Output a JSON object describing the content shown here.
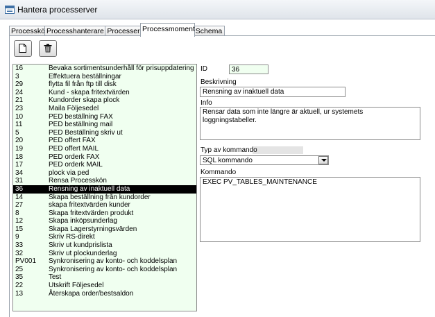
{
  "window": {
    "title": "Hantera processerver"
  },
  "tabs": [
    {
      "label": "Processkö"
    },
    {
      "label": "Processhanterare"
    },
    {
      "label": "Processer"
    },
    {
      "label": "Processmoment"
    },
    {
      "label": "Schema"
    }
  ],
  "toolbar": {
    "new_icon": "new-document-icon",
    "delete_icon": "trash-icon"
  },
  "list": {
    "rows": [
      {
        "id": "16",
        "name": "Bevaka sortimentsunderhåll för prisuppdatering"
      },
      {
        "id": "3",
        "name": "Effektuera beställningar"
      },
      {
        "id": "29",
        "name": "flytta fil från ftp till disk"
      },
      {
        "id": "24",
        "name": "Kund - skapa fritextvärden"
      },
      {
        "id": "21",
        "name": "Kundorder skapa plock"
      },
      {
        "id": "23",
        "name": "Maila Följesedel"
      },
      {
        "id": "10",
        "name": "PED beställning FAX"
      },
      {
        "id": "11",
        "name": "PED beställning mail"
      },
      {
        "id": "5",
        "name": "PED Beställning skriv ut"
      },
      {
        "id": "20",
        "name": "PED offert FAX"
      },
      {
        "id": "19",
        "name": "PED offert MAIL"
      },
      {
        "id": "18",
        "name": "PED orderk FAX"
      },
      {
        "id": "17",
        "name": "PED orderk MAIL"
      },
      {
        "id": "34",
        "name": "plock via ped"
      },
      {
        "id": "31",
        "name": "Rensa Processkön"
      },
      {
        "id": "36",
        "name": "Rensning av inaktuell data"
      },
      {
        "id": "14",
        "name": "Skapa beställning från kundorder"
      },
      {
        "id": "27",
        "name": "skapa fritextvärden kunder"
      },
      {
        "id": "8",
        "name": "Skapa fritextvärden produkt"
      },
      {
        "id": "12",
        "name": "Skapa inköpsunderlag"
      },
      {
        "id": "15",
        "name": "Skapa Lagerstyrningsvärden"
      },
      {
        "id": "9",
        "name": "Skriv  RS-direkt"
      },
      {
        "id": "33",
        "name": "Skriv ut kundprislista"
      },
      {
        "id": "32",
        "name": "Skriv ut plockunderlag"
      },
      {
        "id": "PV001",
        "name": "Synkronisering av konto- och koddelsplan"
      },
      {
        "id": "25",
        "name": "Synkronisering av konto- och koddelsplan"
      },
      {
        "id": "35",
        "name": "Test"
      },
      {
        "id": "22",
        "name": "Utskrift Följesedel"
      },
      {
        "id": "13",
        "name": "Återskapa order/bestsaldon"
      }
    ]
  },
  "form": {
    "id_label": "ID",
    "id_value": "36",
    "beskrivning_label": "Beskrivning",
    "beskrivning_value": "Rensning av inaktuell data",
    "info_label": "Info",
    "info_value": "Rensar data som inte längre är aktuell, ur systemets loggningstabeller.",
    "typ_label": "Typ av kommando",
    "typ_value": "SQL kommando",
    "kommando_label": "Kommando",
    "kommando_value": "EXEC PV_TABLES_MAINTENANCE"
  }
}
